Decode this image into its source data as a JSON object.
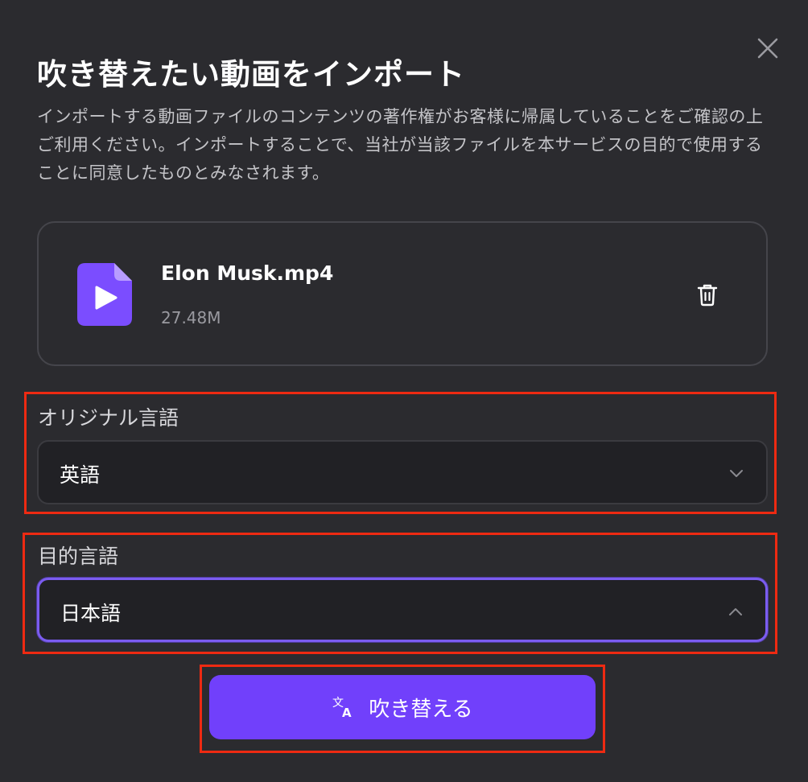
{
  "dialog": {
    "title": "吹き替えたい動画をインポート",
    "description": "インポートする動画ファイルのコンテンツの著作権がお客様に帰属していることをご確認の上ご利用ください。インポートすることで、当社が当該ファイルを本サービスの目的で使用することに同意したものとみなされます。",
    "close_icon": "close-icon"
  },
  "file": {
    "name": "Elon Musk.mp4",
    "size": "27.48M",
    "icon": "video-file-icon",
    "delete_icon": "trash-icon"
  },
  "original_language": {
    "label": "オリジナル言語",
    "value": "英語",
    "chevron_icon": "chevron-down-icon"
  },
  "target_language": {
    "label": "目的言語",
    "value": "日本語",
    "chevron_icon": "chevron-up-icon"
  },
  "action": {
    "label": "吹き替える",
    "icon": "translate-icon"
  },
  "colors": {
    "background": "#2b2b2f",
    "accent": "#7140fb",
    "highlight": "#ee2a12",
    "file_icon": "#7b4dff"
  }
}
